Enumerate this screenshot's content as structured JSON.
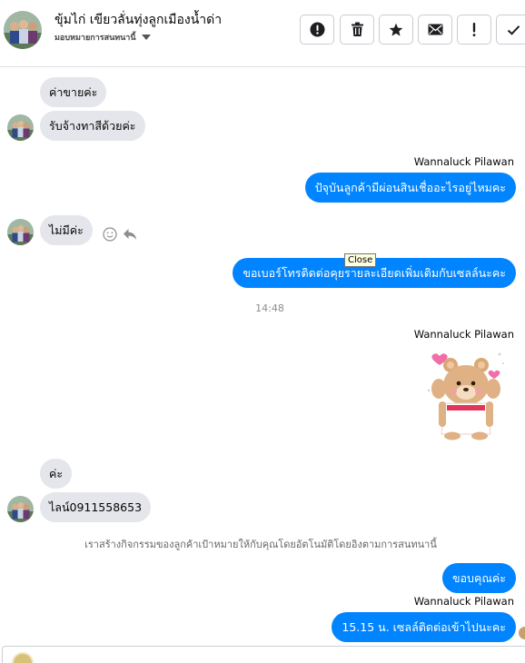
{
  "header": {
    "title": "ขุ้มไก่ เขียวลั่นทุ่งลูกเมืองน้ำด่า",
    "subtitle": "มอบหมายการสนทนานี้",
    "actions": [
      {
        "name": "report",
        "icon": "alert-circle-icon"
      },
      {
        "name": "delete",
        "icon": "trash-icon"
      },
      {
        "name": "star",
        "icon": "star-icon"
      },
      {
        "name": "mark-unread",
        "icon": "envelope-icon"
      },
      {
        "name": "spam",
        "icon": "exclamation-icon"
      },
      {
        "name": "done",
        "icon": "check-icon"
      }
    ]
  },
  "messages": {
    "in1": "ค่าขายค่ะ",
    "in2": "รับจ้างทาสีด้วยค่ะ",
    "sender1": "Wannaluck Pilawan",
    "out1": "ปัจุบันลูกค้ามีผ่อนสินเชื่ออะไรอยู่ไหมคะ",
    "in3": "ไม่มีค่ะ",
    "out2": "ขอเบอร์โทรติดต่อคุยรายละเอียดเพิ่มเติมกับเซลล์นะคะ",
    "tooltip": "Close",
    "time": "14:48",
    "sender2": "Wannaluck Pilawan",
    "in4": "ค่ะ",
    "in5": "ไลน์0911558653",
    "notice": "เราสร้างกิจกรรมของลูกค้าเป้าหมายให้กับคุณโดยอัตโนมัติโดยอิงตามการสนทนานี้",
    "out3": "ขอบคุณค่ะ",
    "sender3": "Wannaluck Pilawan",
    "out4": "15.15 น. เซลล์ติดต่อเข้าไปนะคะ"
  },
  "colors": {
    "outgoing": "#0084ff",
    "incoming": "#e4e6eb"
  }
}
